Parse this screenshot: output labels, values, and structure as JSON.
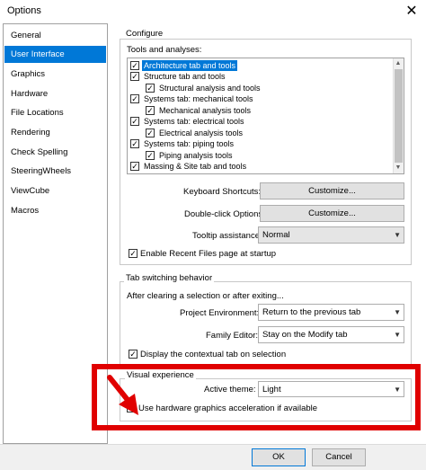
{
  "window": {
    "title": "Options",
    "close_glyph": "✕"
  },
  "sidebar": {
    "items": [
      {
        "label": "General"
      },
      {
        "label": "User Interface",
        "selected": true
      },
      {
        "label": "Graphics"
      },
      {
        "label": "Hardware"
      },
      {
        "label": "File Locations"
      },
      {
        "label": "Rendering"
      },
      {
        "label": "Check Spelling"
      },
      {
        "label": "SteeringWheels"
      },
      {
        "label": "ViewCube"
      },
      {
        "label": "Macros"
      }
    ]
  },
  "configure": {
    "group_label": "Configure",
    "tools_label": "Tools and analyses:",
    "tree": [
      {
        "label": "Architecture tab and tools",
        "checked": true,
        "level": 0,
        "highlighted": true
      },
      {
        "label": "Structure tab and tools",
        "checked": true,
        "level": 0
      },
      {
        "label": "Structural analysis and tools",
        "checked": true,
        "level": 1
      },
      {
        "label": "Systems tab: mechanical tools",
        "checked": true,
        "level": 0
      },
      {
        "label": "Mechanical analysis tools",
        "checked": true,
        "level": 1
      },
      {
        "label": "Systems tab: electrical tools",
        "checked": true,
        "level": 0
      },
      {
        "label": "Electrical analysis tools",
        "checked": true,
        "level": 1
      },
      {
        "label": "Systems tab: piping tools",
        "checked": true,
        "level": 0
      },
      {
        "label": "Piping analysis tools",
        "checked": true,
        "level": 1
      },
      {
        "label": "Massing & Site tab and tools",
        "checked": true,
        "level": 0
      }
    ],
    "keyboard_shortcuts_label": "Keyboard Shortcuts:",
    "keyboard_shortcuts_button": "Customize...",
    "double_click_label": "Double-click Options:",
    "double_click_button": "Customize...",
    "tooltip_label": "Tooltip assistance:",
    "tooltip_value": "Normal",
    "recent_files_label": "Enable Recent Files page at startup",
    "recent_files_checked": true,
    "check_glyph": "✓",
    "dropdown_glyph": "▼",
    "scroll_up_glyph": "▲",
    "scroll_down_glyph": "▼"
  },
  "tab_switching": {
    "group_label": "Tab switching behavior",
    "after_clearing_label": "After clearing a selection or after exiting...",
    "project_env_label": "Project Environment:",
    "project_env_value": "Return to the previous tab",
    "family_editor_label": "Family Editor:",
    "family_editor_value": "Stay on the Modify tab",
    "contextual_label": "Display the contextual tab on selection",
    "contextual_checked": true
  },
  "visual": {
    "group_label": "Visual experience",
    "active_theme_label": "Active theme:",
    "active_theme_value": "Light",
    "hw_accel_label": "Use hardware graphics acceleration if available",
    "hw_accel_checked": false
  },
  "footer": {
    "ok_label": "OK",
    "cancel_label": "Cancel"
  },
  "colors": {
    "accent": "#0078d7",
    "annotation_red": "#e00000"
  }
}
